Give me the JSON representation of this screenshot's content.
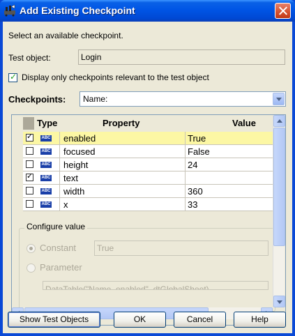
{
  "window": {
    "title": "Add Existing Checkpoint"
  },
  "intro": {
    "text": "Select an available checkpoint."
  },
  "test_object": {
    "label": "Test object:",
    "value": "Login"
  },
  "filter": {
    "label": "Display only checkpoints relevant to the test object",
    "checked": true
  },
  "checkpoints": {
    "label": "Checkpoints:",
    "selected": "Name:"
  },
  "grid": {
    "headers": {
      "type": "Type",
      "property": "Property",
      "value": "Value"
    },
    "rows": [
      {
        "checked": true,
        "icon": "ABC",
        "property": "enabled",
        "value": "True"
      },
      {
        "checked": false,
        "icon": "ABC",
        "property": "focused",
        "value": "False"
      },
      {
        "checked": false,
        "icon": "ABC",
        "property": "height",
        "value": "24"
      },
      {
        "checked": true,
        "icon": "ABC",
        "property": "text",
        "value": ""
      },
      {
        "checked": false,
        "icon": "ABC",
        "property": "width",
        "value": "360"
      },
      {
        "checked": false,
        "icon": "ABC",
        "property": "x",
        "value": "33"
      }
    ]
  },
  "configure": {
    "title": "Configure value",
    "constant_label": "Constant",
    "constant_value": "True",
    "parameter_label": "Parameter",
    "parameter_value": "DataTable(\"Name_enabled\", dtGlobalSheet)"
  },
  "buttons": {
    "show_test_objects": "Show Test Objects",
    "ok": "OK",
    "cancel": "Cancel",
    "help": "Help"
  }
}
